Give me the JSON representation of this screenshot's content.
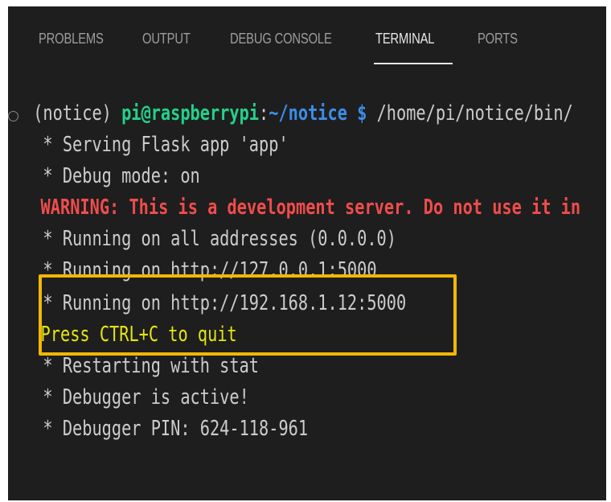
{
  "tabs": [
    {
      "label": "PROBLEMS",
      "active": false
    },
    {
      "label": "OUTPUT",
      "active": false
    },
    {
      "label": "DEBUG CONSOLE",
      "active": false
    },
    {
      "label": "TERMINAL",
      "active": true
    },
    {
      "label": "PORTS",
      "active": false
    }
  ],
  "terminal": {
    "prompt": {
      "prefix": "(notice) ",
      "user_host": "pi@raspberrypi",
      "colon": ":",
      "path": "~/notice",
      "dollar": " $",
      "command": " /home/pi/notice/bin/"
    },
    "lines": [
      " * Serving Flask app 'app'",
      " * Debug mode: on"
    ],
    "warning": "WARNING: This is a development server. Do not use it in",
    "running_all": " * Running on all addresses (0.0.0.0)",
    "running_local": " * Running on http://127.0.0.1:5000",
    "running_lan": " * Running on http://192.168.1.12:5000",
    "quit": "Press CTRL+C to quit",
    "restart": " * Restarting with stat",
    "debugger_active": " * Debugger is active!",
    "debugger_pin": " * Debugger PIN: 624-118-961"
  },
  "colors": {
    "background": "#1e1e1e",
    "highlight_box": "#f2b705",
    "user_host": "#23d18b",
    "path": "#3b8eea",
    "warning": "#f14c4c",
    "quit": "#e5e510"
  }
}
